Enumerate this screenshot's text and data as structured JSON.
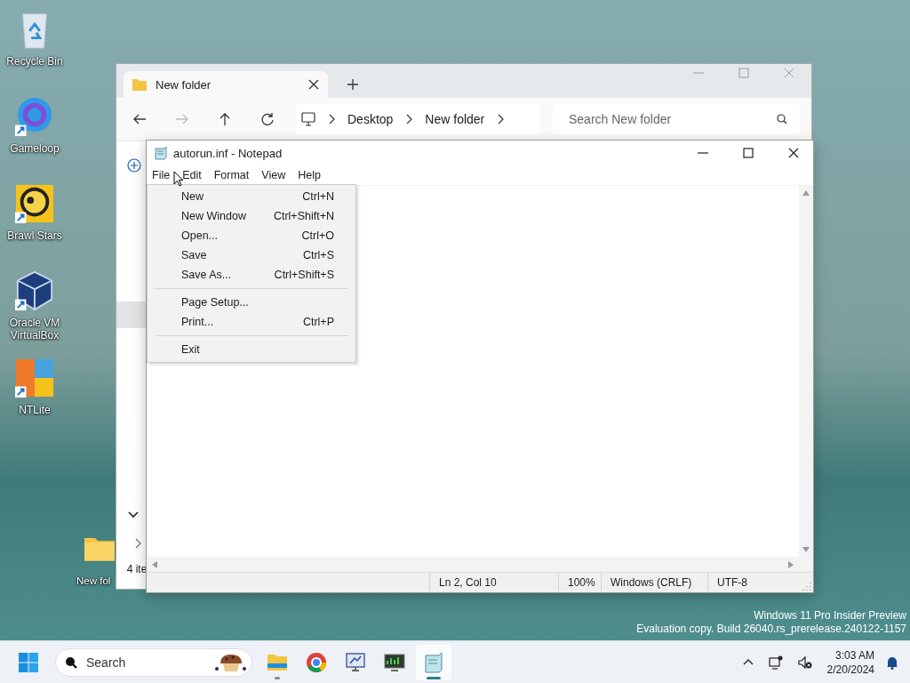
{
  "desktop_icons": [
    {
      "label": "Recycle Bin",
      "kind": "recycle"
    },
    {
      "label": "Gameloop",
      "kind": "ring"
    },
    {
      "label": "Brawl Stars",
      "kind": "skull"
    },
    {
      "label": "Oracle VM VirtualBox",
      "kind": "cube"
    },
    {
      "label": "NTLite",
      "kind": "tile"
    }
  ],
  "desktop_folder": {
    "label": "New fol"
  },
  "explorer": {
    "tabs": [
      {
        "label": "New folder",
        "selected": true
      }
    ],
    "breadcrumb": [
      "Desktop",
      "New folder"
    ],
    "search": {
      "placeholder": "Search New folder"
    },
    "status": "4 ite"
  },
  "notepad": {
    "title": "autorun.inf - Notepad",
    "menus": [
      "File",
      "Edit",
      "Format",
      "View",
      "Help"
    ],
    "file_menu": [
      [
        {
          "label": "New",
          "shortcut": "Ctrl+N"
        },
        {
          "label": "New Window",
          "shortcut": "Ctrl+Shift+N"
        },
        {
          "label": "Open...",
          "shortcut": "Ctrl+O"
        },
        {
          "label": "Save",
          "shortcut": "Ctrl+S"
        },
        {
          "label": "Save As...",
          "shortcut": "Ctrl+Shift+S"
        }
      ],
      [
        {
          "label": "Page Setup..."
        },
        {
          "label": "Print...",
          "shortcut": "Ctrl+P"
        }
      ],
      [
        {
          "label": "Exit"
        }
      ]
    ],
    "status": [
      "Ln 2, Col 10",
      "100%",
      "Windows (CRLF)",
      "UTF-8"
    ]
  },
  "build_info": [
    "Windows 11 Pro Insider Preview",
    "Evaluation copy. Build 26040.rs_prerelease.240122-1157"
  ],
  "taskbar": {
    "search": {
      "placeholder": "Search"
    },
    "apps": [
      {
        "kind": "explorer",
        "running": true,
        "selected": false
      },
      {
        "kind": "browser",
        "running": false,
        "selected": false
      },
      {
        "kind": "monitor",
        "running": false,
        "selected": false
      },
      {
        "kind": "chart",
        "running": false,
        "selected": false
      },
      {
        "kind": "notepad",
        "running": true,
        "selected": true
      }
    ],
    "time": "3:03 AM",
    "date": "2/20/2024"
  }
}
